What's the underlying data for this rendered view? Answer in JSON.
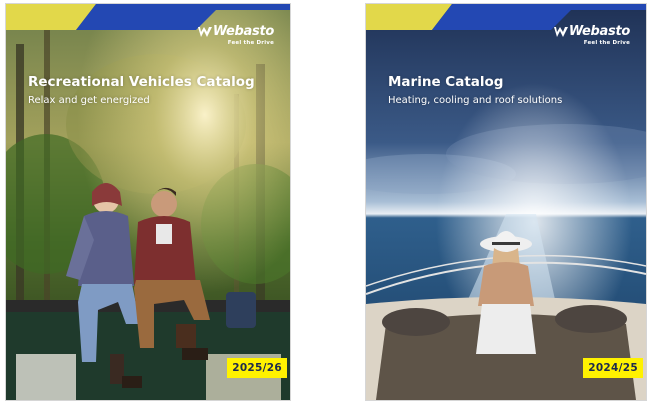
{
  "catalogs": [
    {
      "brand": "Webasto",
      "tagline": "Feel the Drive",
      "title": "Recreational Vehicles Catalog",
      "subtitle": "Relax and get energized",
      "year": "2025/26"
    },
    {
      "brand": "Webasto",
      "tagline": "Feel the Drive",
      "title": "Marine Catalog",
      "subtitle": "Heating, cooling and roof solutions",
      "year": "2024/25"
    }
  ],
  "colors": {
    "brand_blue": "#1f3a93",
    "accent_yellow": "#fff200",
    "year_text": "#1d2a4d"
  }
}
